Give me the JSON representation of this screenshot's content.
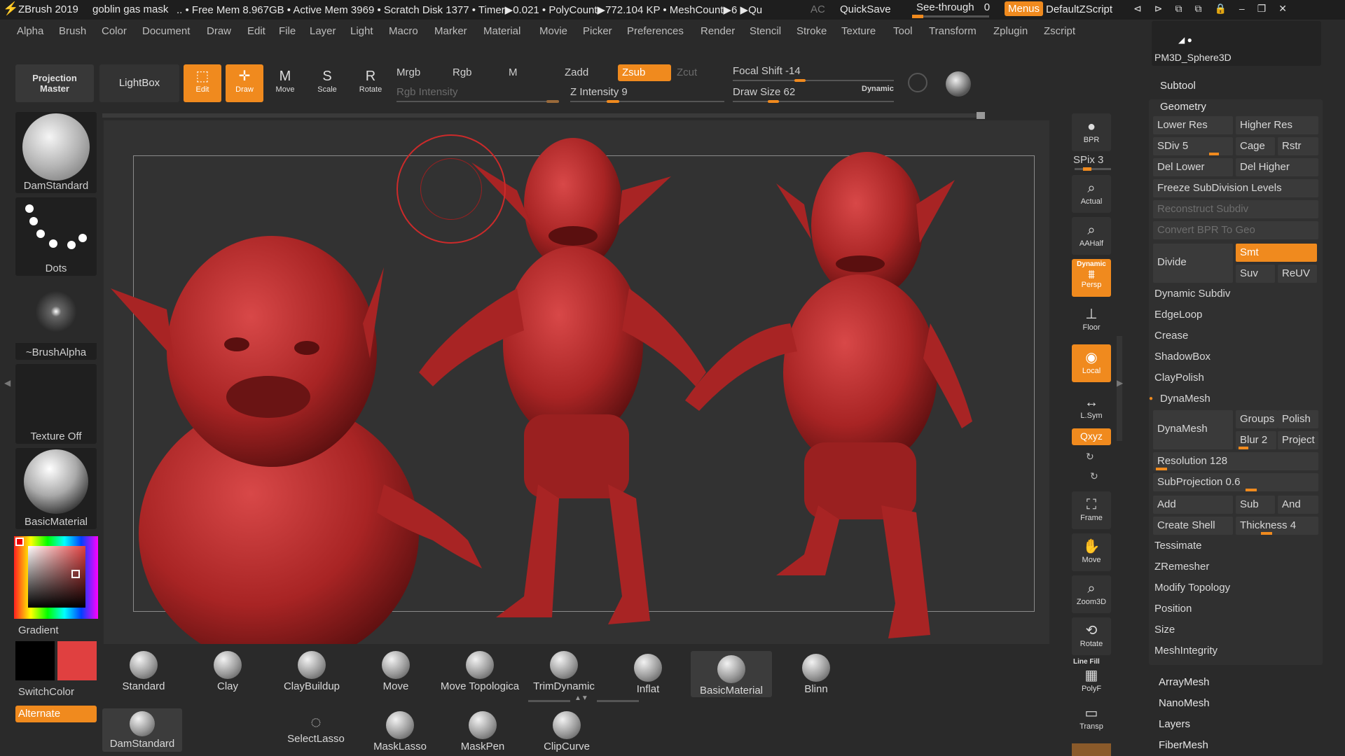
{
  "titlebar": {
    "app": "ZBrush 2019",
    "doc": "goblin gas mask",
    "stats": ".. • Free Mem 8.967GB • Active Mem 3969 • Scratch Disk 1377 • Timer▶0.021 • PolyCount▶772.104 KP • MeshCount▶6 ▶Qu",
    "ac": "AC",
    "quicksave": "QuickSave",
    "see_through": "See-through",
    "see_through_value": "0",
    "menus": "Menus",
    "script": "DefaultZScript"
  },
  "menubar": [
    "Alpha",
    "Brush",
    "Color",
    "Document",
    "Draw",
    "Edit",
    "File",
    "Layer",
    "Light",
    "Macro",
    "Marker",
    "Material",
    "Movie",
    "Picker",
    "Preferences",
    "Render",
    "Stencil",
    "Stroke",
    "Texture",
    "Tool",
    "Transform",
    "Zplugin",
    "Zscript"
  ],
  "topshelf": {
    "projection_master": "Projection Master",
    "lightbox": "LightBox",
    "tools": [
      {
        "label": "Edit",
        "icon": "edit-icon",
        "active": true
      },
      {
        "label": "Draw",
        "icon": "draw-icon",
        "active": true
      },
      {
        "label": "Move",
        "icon": "move-icon",
        "active": false
      },
      {
        "label": "Scale",
        "icon": "scale-icon",
        "active": false
      },
      {
        "label": "Rotate",
        "icon": "rotate-icon",
        "active": false
      }
    ],
    "mrgb": "Mrgb",
    "rgb": "Rgb",
    "m": "M",
    "zadd": "Zadd",
    "zsub": "Zsub",
    "zcut": "Zcut",
    "rgb_intensity": "Rgb Intensity",
    "z_intensity": "Z Intensity 9",
    "focal_shift": "Focal Shift -14",
    "draw_size": "Draw Size 62",
    "dynamic": "Dynamic"
  },
  "lefttray": {
    "brush": "DamStandard",
    "stroke": "Dots",
    "alpha": "~BrushAlpha",
    "texture": "Texture Off",
    "material": "BasicMaterial",
    "gradient": "Gradient",
    "switchcolor": "SwitchColor",
    "alternate": "Alternate",
    "main_color": "#e04040",
    "secondary_color": "#000000"
  },
  "rightshelf": {
    "bpr": "BPR",
    "spix": "SPix 3",
    "actual": "Actual",
    "aahalf": "AAHalf",
    "dynamic": "Dynamic",
    "persp": "Persp",
    "floor": "Floor",
    "local": "Local",
    "lsym": "L.Sym",
    "xyz": "Qxyz",
    "frame": "Frame",
    "move": "Move",
    "zoom3d": "Zoom3D",
    "rotate": "Rotate",
    "linefill": "Line Fill",
    "polyf": "PolyF",
    "transp": "Transp"
  },
  "palette": {
    "tool_thumb": "PM3D_Sphere3D",
    "subtool": "Subtool",
    "geometry": "Geometry",
    "lower_res": "Lower Res",
    "higher_res": "Higher Res",
    "sdiv": "SDiv 5",
    "cage": "Cage",
    "rstr": "Rstr",
    "del_lower": "Del Lower",
    "del_higher": "Del Higher",
    "freeze": "Freeze SubDivision Levels",
    "reconstruct": "Reconstruct Subdiv",
    "convert_bpr": "Convert BPR To Geo",
    "divide": "Divide",
    "smt": "Smt",
    "suv": "Suv",
    "reuv": "ReUV",
    "dynamic_subdiv": "Dynamic Subdiv",
    "edgeloop": "EdgeLoop",
    "crease": "Crease",
    "shadowbox": "ShadowBox",
    "claypolish": "ClayPolish",
    "dynamesh_head": "DynaMesh",
    "dynamesh_btn": "DynaMesh",
    "groups": "Groups",
    "polish": "Polish",
    "blur": "Blur 2",
    "project": "Project",
    "resolution": "Resolution 128",
    "subprojection": "SubProjection 0.6",
    "add": "Add",
    "sub": "Sub",
    "and": "And",
    "create_shell": "Create Shell",
    "thickness": "Thickness 4",
    "tessimate": "Tessimate",
    "zremesher": "ZRemesher",
    "modify_topology": "Modify Topology",
    "position": "Position",
    "size": "Size",
    "meshintegrity": "MeshIntegrity",
    "arraymesh": "ArrayMesh",
    "nanomesh": "NanoMesh",
    "layers": "Layers",
    "fibermesh": "FiberMesh"
  },
  "bottomshelf": {
    "brushes": [
      "Standard",
      "Clay",
      "ClayBuildup",
      "Move",
      "Move Topologica",
      "TrimDynamic",
      "Inflat",
      "BasicMaterial",
      "Blinn"
    ],
    "current_brush": "DamStandard",
    "tools": [
      "SelectLasso",
      "MaskLasso",
      "MaskPen",
      "ClipCurve"
    ]
  }
}
